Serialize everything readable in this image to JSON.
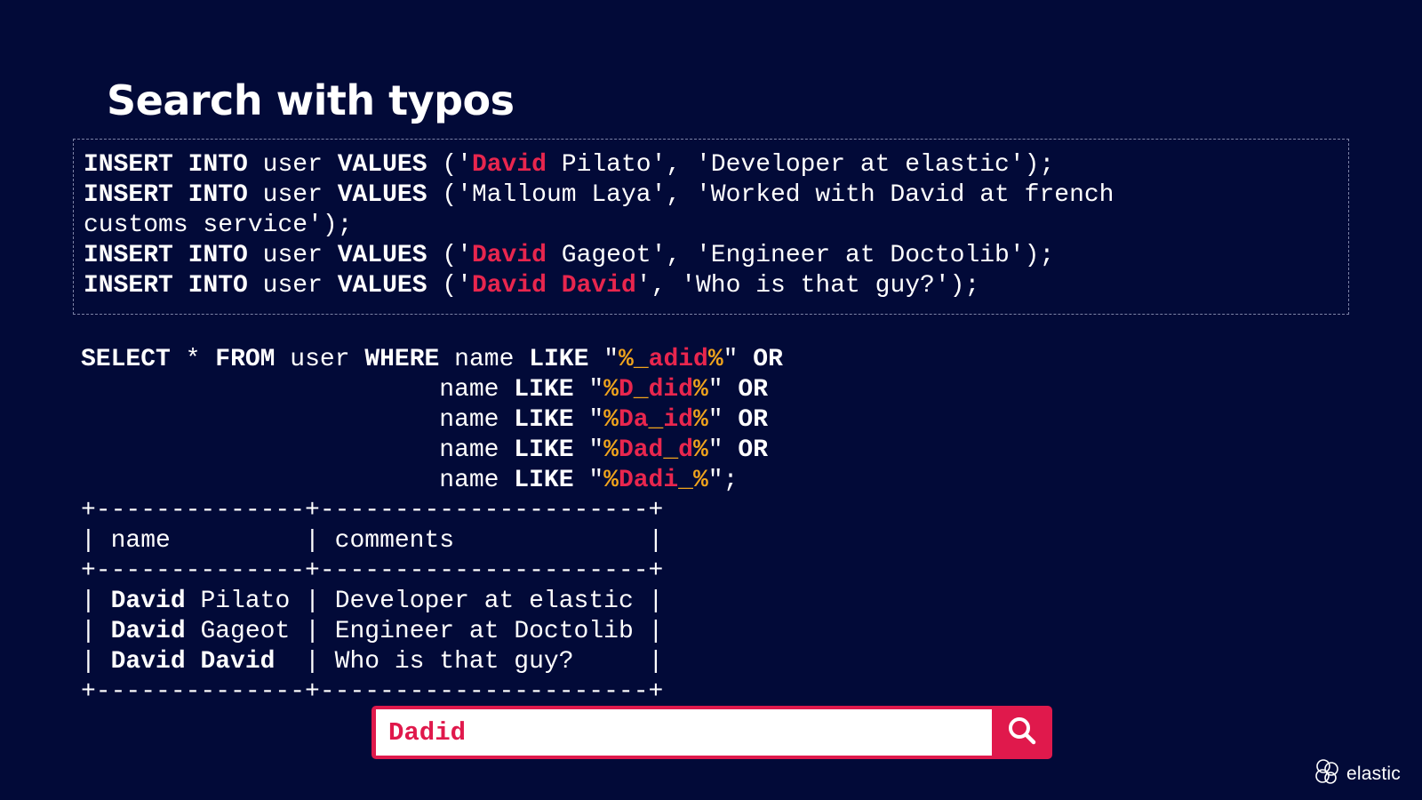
{
  "slide": {
    "title": "Search with typos"
  },
  "insert_statements": [
    {
      "kw1": "INSERT",
      "kw2": "INTO",
      "table": "user",
      "kw3": "VALUES",
      "open": "('",
      "hl": "David",
      "rest": " Pilato', 'Developer at elastic');"
    },
    {
      "kw1": "INSERT",
      "kw2": "INTO",
      "table": "user",
      "kw3": "VALUES",
      "open": "('",
      "hl": "",
      "rest": "Malloum Laya', 'Worked with David at french",
      "rest2": "customs service');"
    },
    {
      "kw1": "INSERT",
      "kw2": "INTO",
      "table": "user",
      "kw3": "VALUES",
      "open": "('",
      "hl": "David",
      "rest": " Gageot', 'Engineer at Doctolib');"
    },
    {
      "kw1": "INSERT",
      "kw2": "INTO",
      "table": "user",
      "kw3": "VALUES",
      "open": "('",
      "hl": "David David",
      "rest": "', 'Who is that guy?');"
    }
  ],
  "select_query": {
    "select": "SELECT",
    "star": "*",
    "from": "FROM",
    "table": "user",
    "where": "WHERE",
    "column": "name",
    "like": "LIKE",
    "or": "OR",
    "patterns": [
      {
        "pct1": "%",
        "red": "",
        "under": "_",
        "red2": "adid",
        "pct2": "%",
        "end": "OR"
      },
      {
        "pct1": "%",
        "red": "D",
        "under": "_",
        "red2": "did",
        "pct2": "%",
        "end": "OR"
      },
      {
        "pct1": "%",
        "red": "Da",
        "under": "_",
        "red2": "id",
        "pct2": "%",
        "end": "OR"
      },
      {
        "pct1": "%",
        "red": "Dad",
        "under": "_",
        "red2": "d",
        "pct2": "%",
        "end": "OR"
      },
      {
        "pct1": "%",
        "red": "Dadi",
        "under": "_",
        "red2": "",
        "pct2": "%",
        "end": ";"
      }
    ]
  },
  "result_table": {
    "border": "+--------------+----------------------+",
    "headers": [
      "name",
      "comments"
    ],
    "rows": [
      {
        "first": "David",
        "last": "Pilato",
        "comment": "Developer at elastic"
      },
      {
        "first": "David",
        "last": "Gageot",
        "comment": "Engineer at Doctolib"
      },
      {
        "first": "David",
        "last": "David",
        "comment": "Who is that guy?"
      }
    ]
  },
  "search": {
    "value": "Dadid",
    "icon": "search-icon"
  },
  "brand": {
    "logo_text": "elastic",
    "icon": "elastic-logo-icon"
  },
  "colors": {
    "background": "#020a38",
    "highlight_red": "#e8264e",
    "wildcard_orange": "#f0a41c",
    "search_red": "#e0194c"
  }
}
